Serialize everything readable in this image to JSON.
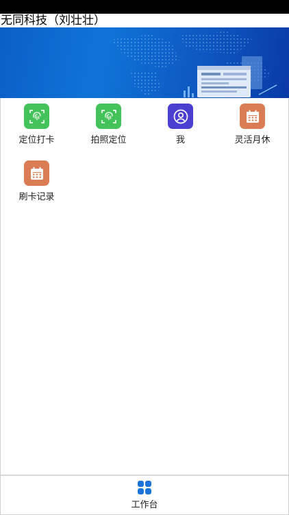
{
  "header": {
    "title": "无同科技（刘壮壮）"
  },
  "colors": {
    "green": "#44c35a",
    "purple": "#4b3fd1",
    "orange": "#db7d54",
    "tab_blue": "#1a73d9"
  },
  "apps": [
    {
      "label": "定位打卡",
      "icon": "fingerprint-scan-icon",
      "color": "#44c35a"
    },
    {
      "label": "拍照定位",
      "icon": "fingerprint-scan-icon",
      "color": "#44c35a"
    },
    {
      "label": "我",
      "icon": "user-circle-icon",
      "color": "#4b3fd1"
    },
    {
      "label": "灵活月休",
      "icon": "calendar-icon",
      "color": "#db7d54"
    },
    {
      "label": "刷卡记录",
      "icon": "calendar-icon",
      "color": "#db7d54"
    }
  ],
  "bottom_nav": {
    "tab_label": "工作台",
    "icon": "grid-icon"
  }
}
